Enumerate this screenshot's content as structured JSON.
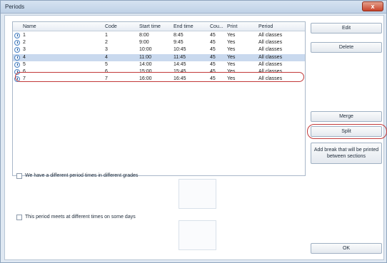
{
  "window": {
    "title": "Periods",
    "close_glyph": "x"
  },
  "table": {
    "columns": [
      "Name",
      "Code",
      "Start time",
      "End time",
      "Cou...",
      "Print",
      "Period"
    ],
    "rows": [
      {
        "name": "1",
        "code": "1",
        "start": "8:00",
        "end": "8:45",
        "count": "45",
        "print": "Yes",
        "period": "All classes"
      },
      {
        "name": "2",
        "code": "2",
        "start": "9:00",
        "end": "9:45",
        "count": "45",
        "print": "Yes",
        "period": "All classes"
      },
      {
        "name": "3",
        "code": "3",
        "start": "10:00",
        "end": "10:45",
        "count": "45",
        "print": "Yes",
        "period": "All classes"
      },
      {
        "name": "4",
        "code": "4",
        "start": "11:00",
        "end": "11:45",
        "count": "45",
        "print": "Yes",
        "period": "All classes"
      },
      {
        "name": "5",
        "code": "5",
        "start": "14:00",
        "end": "14:45",
        "count": "45",
        "print": "Yes",
        "period": "All classes"
      },
      {
        "name": "6",
        "code": "6",
        "start": "15:00",
        "end": "15:45",
        "count": "45",
        "print": "Yes",
        "period": "All classes"
      },
      {
        "name": "7",
        "code": "7",
        "start": "16:00",
        "end": "16:45",
        "count": "45",
        "print": "Yes",
        "period": "All classes"
      }
    ],
    "selected_row": 3
  },
  "buttons": {
    "edit": "Edit",
    "delete": "Delete",
    "merge": "Merge",
    "split": "Split",
    "add_break": "Add break that will be printed between sections",
    "ok": "OK"
  },
  "options": {
    "different_grades": "We have a different period times in different grades",
    "different_days": "This period meets at different times on some days"
  },
  "colors": {
    "accent_highlight": "#c23a3a",
    "selected_row": "#c9d9ee"
  }
}
